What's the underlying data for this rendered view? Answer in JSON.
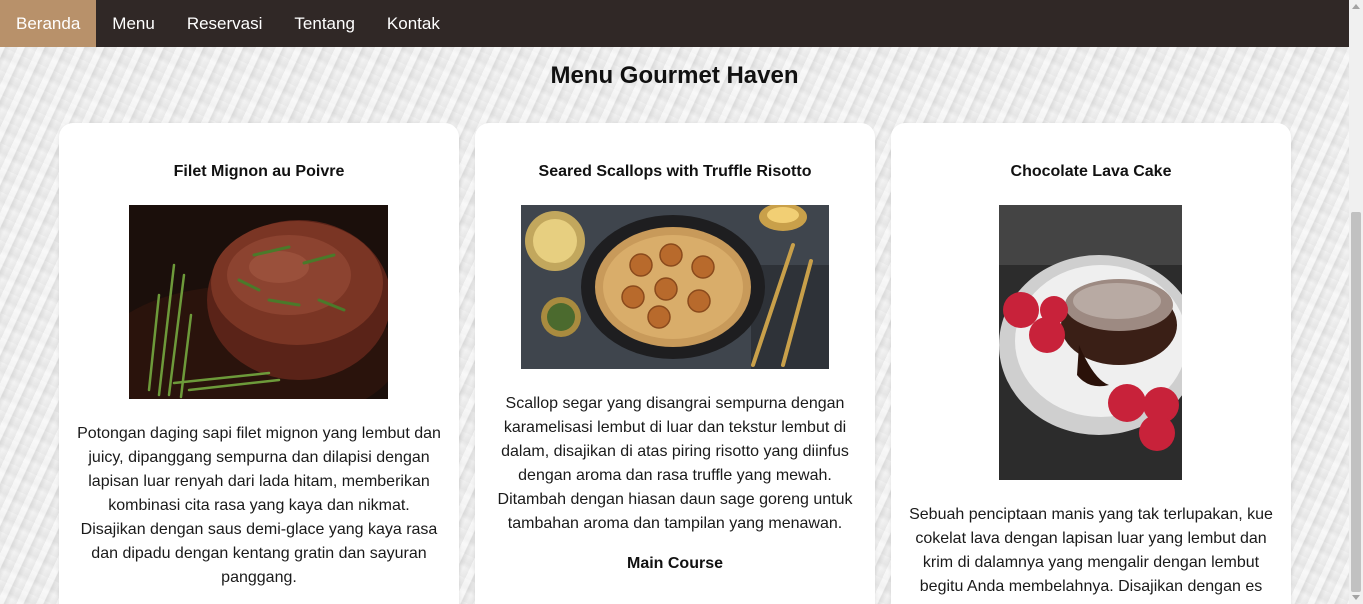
{
  "nav": {
    "items": [
      {
        "label": "Beranda",
        "active": true
      },
      {
        "label": "Menu",
        "active": false
      },
      {
        "label": "Reservasi",
        "active": false
      },
      {
        "label": "Tentang",
        "active": false
      },
      {
        "label": "Kontak",
        "active": false
      }
    ]
  },
  "page": {
    "title": "Menu Gourmet Haven"
  },
  "menu": {
    "items": [
      {
        "title": "Filet Mignon au Poivre",
        "image": "filet-mignon-photo",
        "description": "Potongan daging sapi filet mignon yang lembut dan juicy, dipanggang sempurna dan dilapisi dengan lapisan luar renyah dari lada hitam, memberikan kombinasi cita rasa yang kaya dan nikmat. Disajikan dengan saus demi-glace yang kaya rasa dan dipadu dengan kentang gratin dan sayuran panggang.",
        "category": ""
      },
      {
        "title": "Seared Scallops with Truffle Risotto",
        "image": "scallops-risotto-photo",
        "description": "Scallop segar yang disangrai sempurna dengan karamelisasi lembut di luar dan tekstur lembut di dalam, disajikan di atas piring risotto yang diinfus dengan aroma dan rasa truffle yang mewah. Ditambah dengan hiasan daun sage goreng untuk tambahan aroma dan tampilan yang menawan.",
        "category": "Main Course"
      },
      {
        "title": "Chocolate Lava Cake",
        "image": "chocolate-lava-cake-photo",
        "description": "Sebuah penciptaan manis yang tak terlupakan, kue cokelat lava dengan lapisan luar yang lembut dan krim di dalamnya yang mengalir dengan lembut begitu Anda membelahnya. Disajikan dengan es",
        "category": ""
      }
    ]
  },
  "colors": {
    "nav_bg": "#302826",
    "nav_active": "#b8916a",
    "card_bg": "#ffffff"
  }
}
